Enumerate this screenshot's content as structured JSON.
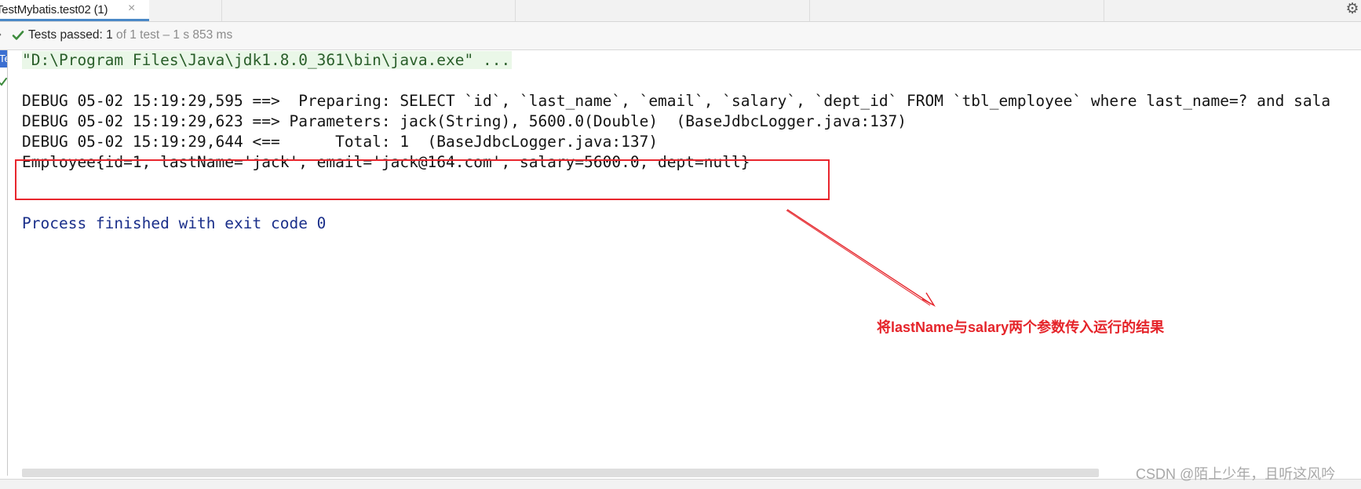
{
  "tab": {
    "title": "TestMybatis.test02 (1)",
    "close_glyph": "×"
  },
  "toolbar": {
    "settings_glyph": "⚙"
  },
  "status": {
    "chevron": "›",
    "passed_label": "Tests passed: 1",
    "detail": "of 1 test – 1 s 853 ms",
    "status_color": "#3d8b3d"
  },
  "gutter": {
    "marker_text": "Te"
  },
  "console": {
    "lines": [
      "\"D:\\Program Files\\Java\\jdk1.8.0_361\\bin\\java.exe\" ...",
      "",
      "DEBUG 05-02 15:19:29,595 ==>  Preparing: SELECT `id`, `last_name`, `email`, `salary`, `dept_id` FROM `tbl_employee` where last_name=? and sala",
      "DEBUG 05-02 15:19:29,623 ==> Parameters: jack(String), 5600.0(Double)  (BaseJdbcLogger.java:137)",
      "DEBUG 05-02 15:19:29,644 <==      Total: 1  (BaseJdbcLogger.java:137)",
      "Employee{id=1, lastName='jack', email='jack@164.com', salary=5600.0, dept=null}",
      "",
      "",
      "Process finished with exit code 0"
    ]
  },
  "annotation": {
    "text": "将lastName与salary两个参数传入运行的结果",
    "color": "#e5242a"
  },
  "watermark": "CSDN @陌上少年，且听这风吟"
}
